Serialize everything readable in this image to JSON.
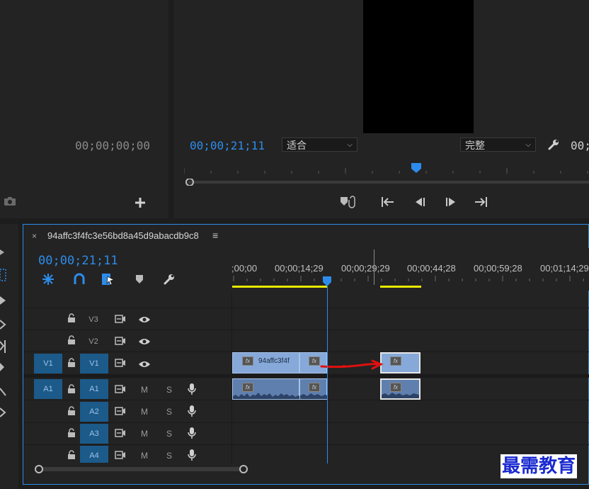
{
  "source_monitor": {
    "timecode": "00;00;00;00"
  },
  "program_monitor": {
    "timecode": "00;00;21;11",
    "fit_dropdown": "适合",
    "quality_dropdown": "完整",
    "timecode_right": "00;"
  },
  "timeline": {
    "sequence_name": "94affc3f4fc3e56bd8a45d9abacdb9c8",
    "timecode": "00;00;21;11",
    "ruler_labels": [
      ";00;00",
      "00;00;14;29",
      "00;00;29;29",
      "00;00;44;28",
      "00;00;59;28",
      "00;01;14;29"
    ],
    "video_tracks": [
      {
        "target": "",
        "name": "V3"
      },
      {
        "target": "",
        "name": "V2"
      },
      {
        "target": "V1",
        "name": "V1"
      }
    ],
    "audio_tracks": [
      {
        "target": "A1",
        "name": "A1",
        "m": "M",
        "s": "S"
      },
      {
        "target": "",
        "name": "A2",
        "m": "M",
        "s": "S"
      },
      {
        "target": "",
        "name": "A3",
        "m": "M",
        "s": "S"
      },
      {
        "target": "",
        "name": "A4",
        "m": "M",
        "s": "S"
      }
    ],
    "clips": {
      "v1_clip_name": "94affc3f4f",
      "fx_label": "fx"
    }
  },
  "watermark": "最需教育",
  "colors": {
    "accent": "#2d8ceb",
    "clip": "#86a9d9",
    "work_area": "#e8e800",
    "annotation": "#e01010"
  }
}
